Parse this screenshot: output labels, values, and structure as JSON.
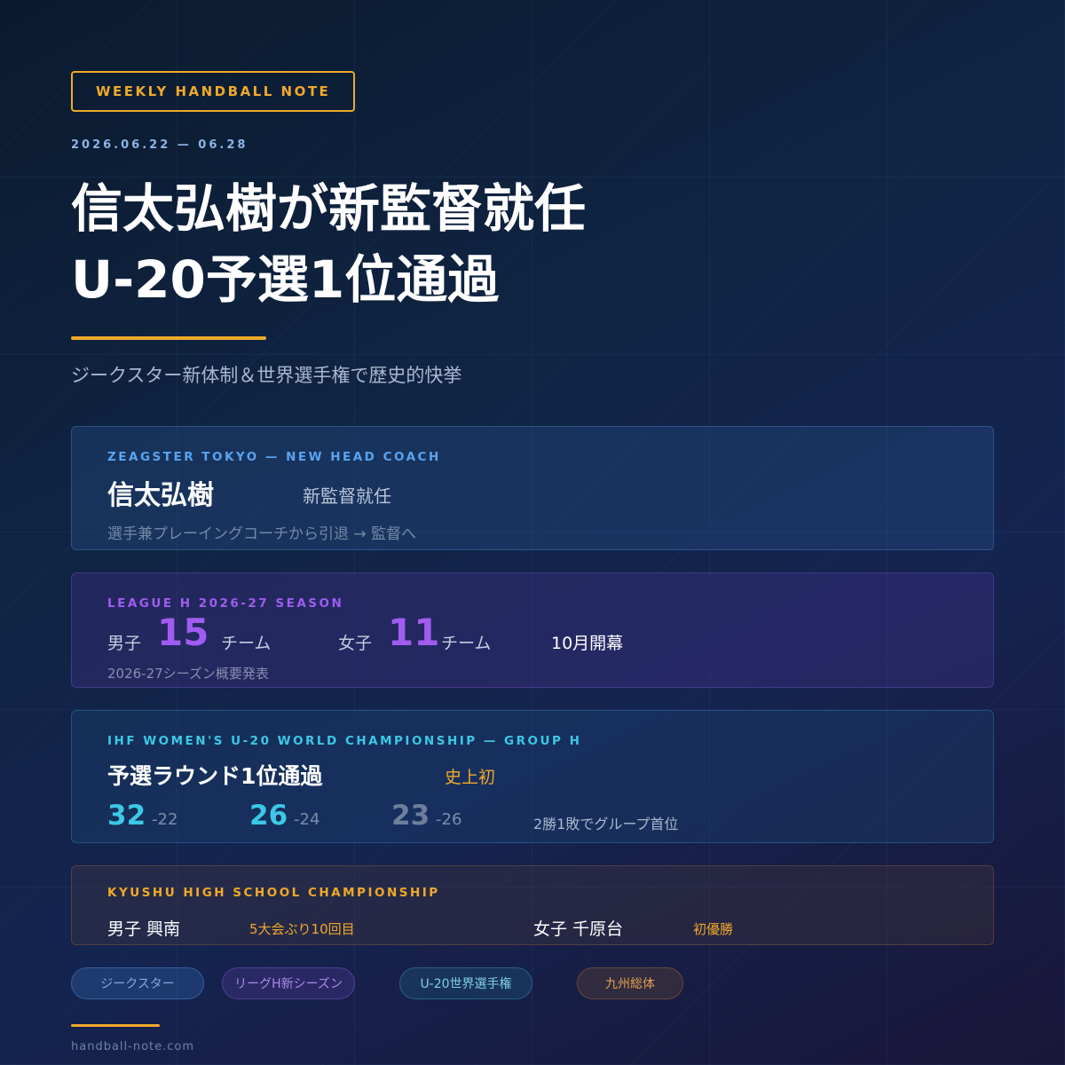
{
  "badge": "WEEKLY HANDBALL NOTE",
  "date_range": "2026.06.22 — 06.28",
  "headline": {
    "line1": "信太弘樹が新監督就任",
    "line2": "U-20予選1位通過"
  },
  "subheadline": "ジークスター新体制＆世界選手権で歴史的快挙",
  "cards": {
    "coach": {
      "label": "ZEAGSTER TOKYO — NEW HEAD COACH",
      "name": "信太弘樹",
      "role": "新監督就任",
      "note": "選手兼プレーイングコーチから引退 → 監督へ"
    },
    "league": {
      "label": "LEAGUE H 2026-27 SEASON",
      "men_label": "男子",
      "men_count": "15",
      "men_unit": "チーム",
      "women_label": "女子",
      "women_count": "11",
      "women_unit": "チーム",
      "opening": "10月開幕",
      "note": "2026-27シーズン概要発表"
    },
    "worlds": {
      "label": "IHF WOMEN'S U-20 WORLD CHAMPIONSHIP — GROUP H",
      "result": "予選ラウンド1位通過",
      "highlight": "史上初",
      "scores": [
        {
          "for": "32",
          "against": "-22"
        },
        {
          "for": "26",
          "against": "-24"
        },
        {
          "for": "23",
          "against": "-26"
        }
      ],
      "summary": "2勝1敗でグループ首位"
    },
    "kyushu": {
      "label": "KYUSHU HIGH SCHOOL CHAMPIONSHIP",
      "men": "男子 興南",
      "men_note": "5大会ぶり10回目",
      "women": "女子 千原台",
      "women_note": "初優勝"
    }
  },
  "tags": [
    "ジークスター",
    "リーグH新シーズン",
    "U-20世界選手権",
    "九州総体"
  ],
  "footer": "handball-note.com",
  "colors": {
    "accent": "#f0a92a",
    "blue": "#5aa4f0",
    "purple": "#a05cf0",
    "cyan": "#3cc8e6",
    "orange": "#f0a92a"
  }
}
